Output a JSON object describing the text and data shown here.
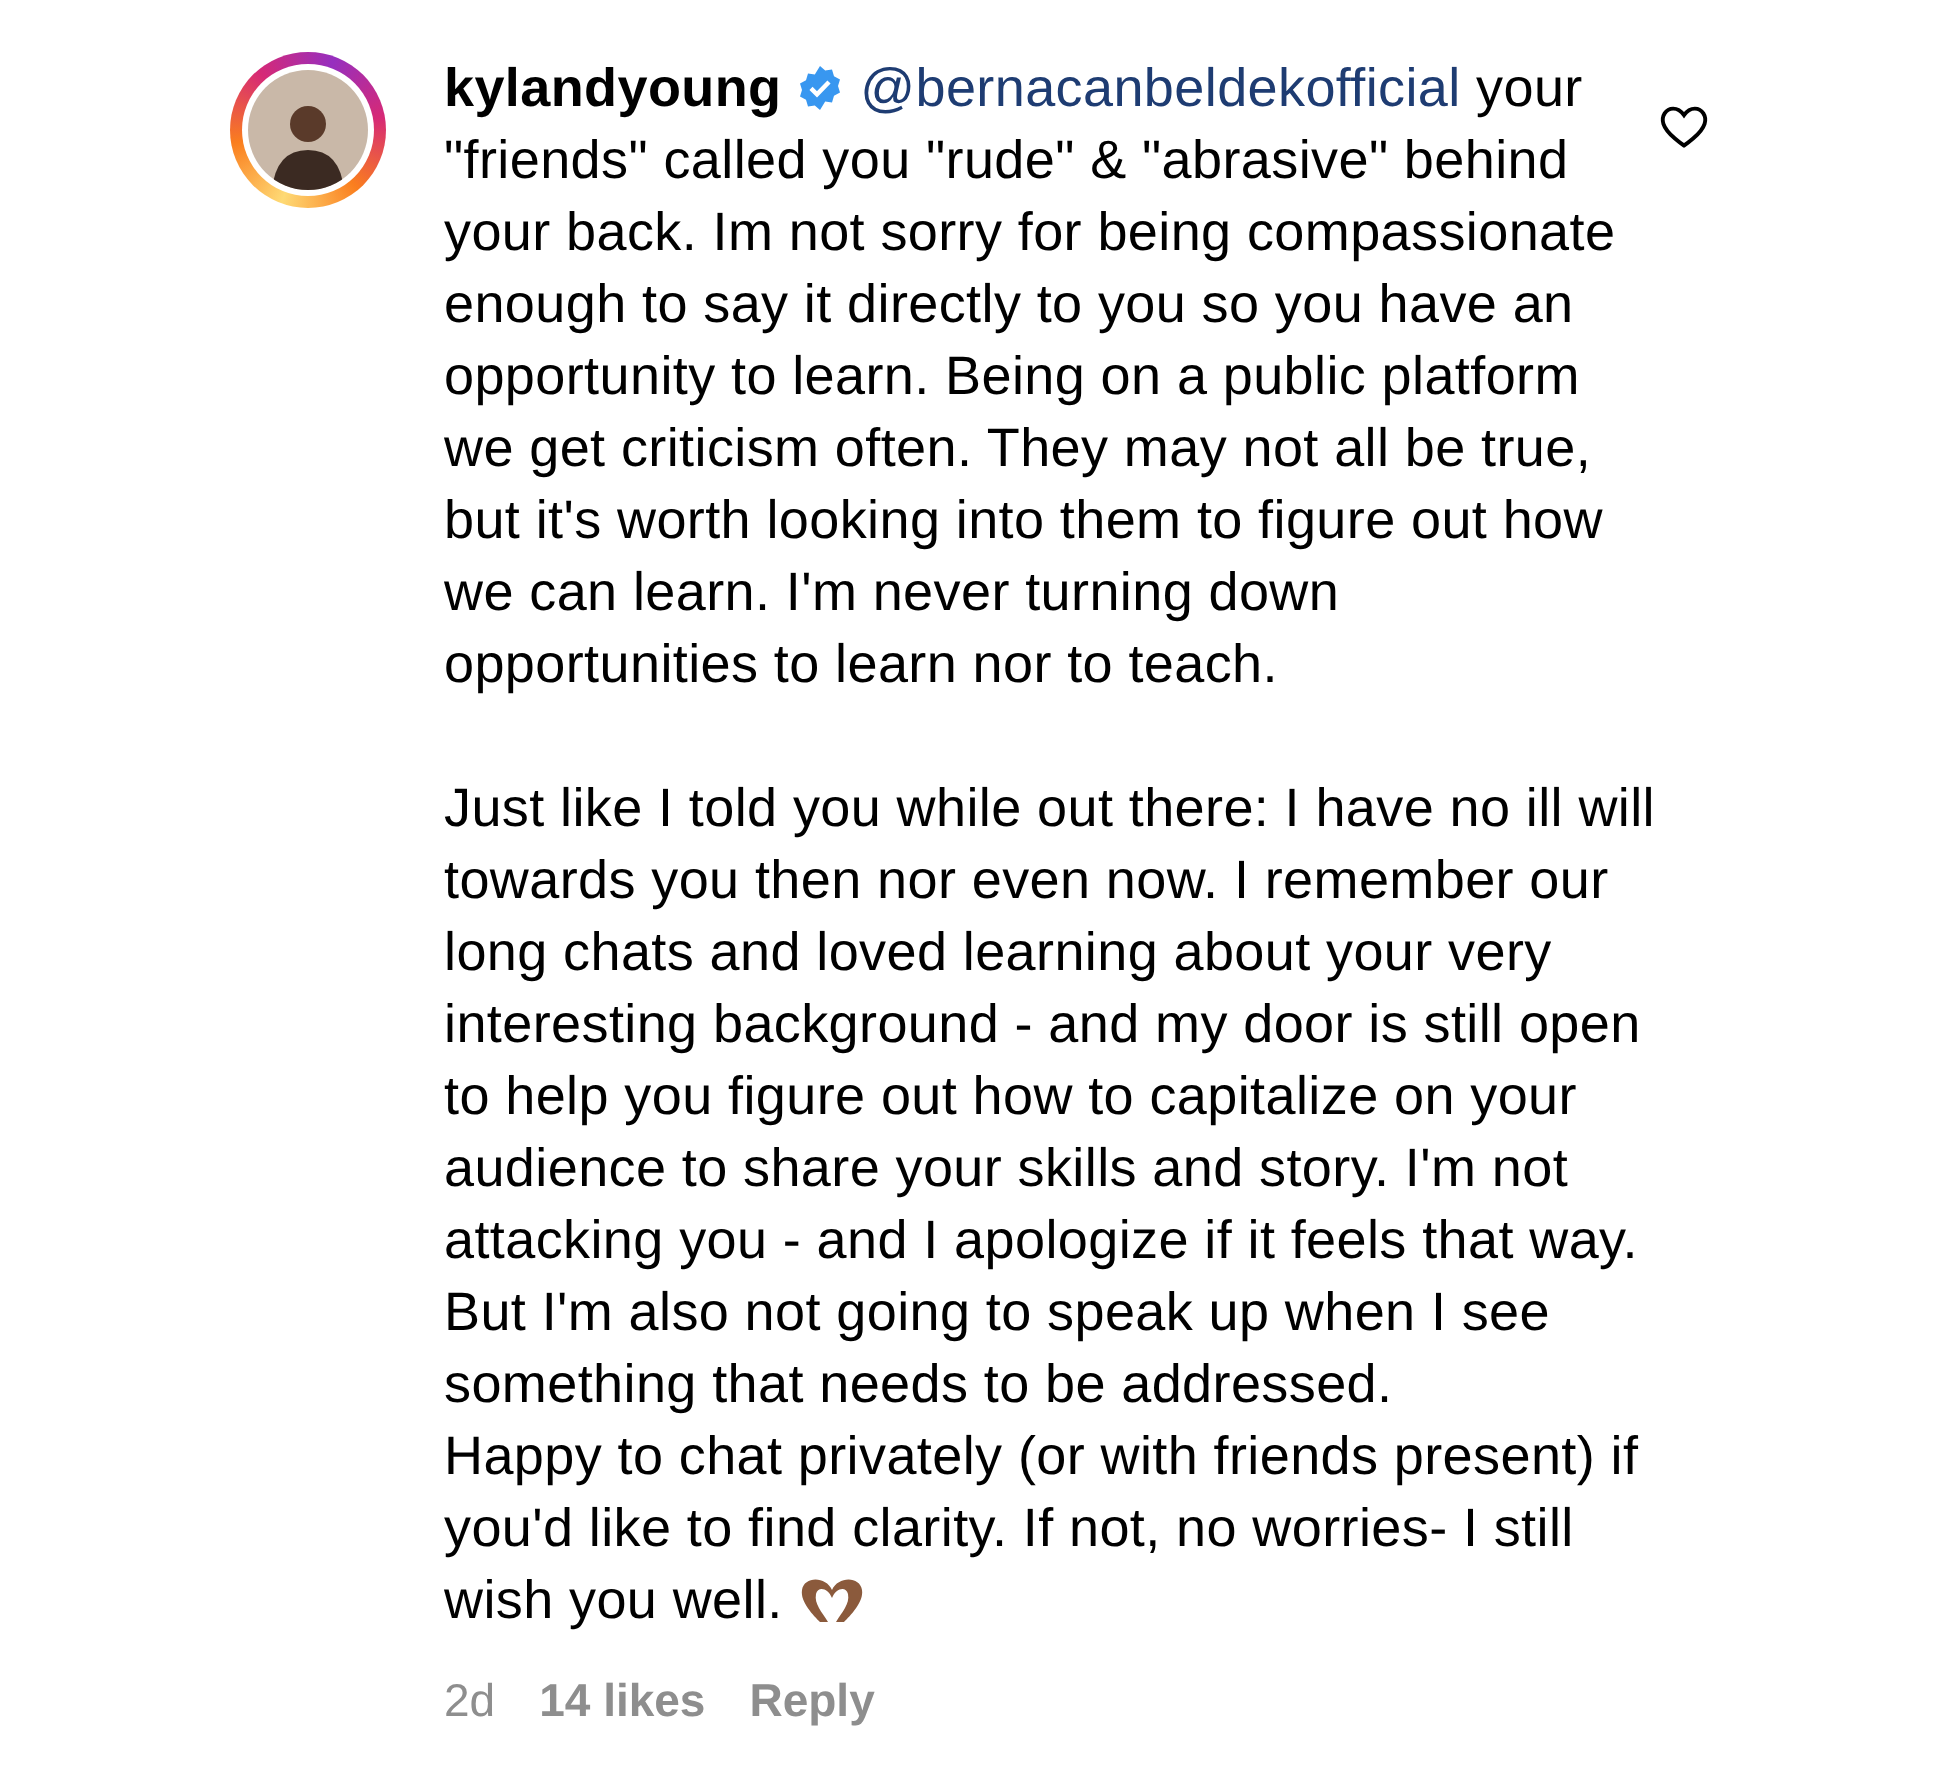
{
  "comment": {
    "username": "kylandyoung",
    "verified": true,
    "mention": "@bernacanbeldekofficial",
    "text": "your \"friends\" called you \"rude\" & \"abrasive\" behind your back. Im not sorry for being compassionate enough to say it directly to you so you have an opportunity to learn. Being on a public platform we get criticism often. They may not all be true, but it's worth looking into them to figure out how we can learn. I'm never turning down opportunities to learn nor to teach.\n\nJust like I told you while out there: I have no ill will towards you then nor even now. I remember our long chats and loved learning about your very interesting background - and my door is still open to help you figure out how to capitalize on your audience to share your skills and story. I'm not attacking you - and I apologize if it feels that way. But I'm also not going to speak up when I see something that needs to be addressed.\nHappy to chat privately (or with friends present) if you'd like to find clarity. If not, no worries- I still wish you well.",
    "emoji": true,
    "time": "2d",
    "likes": "14 likes",
    "reply": "Reply",
    "liked": false
  }
}
